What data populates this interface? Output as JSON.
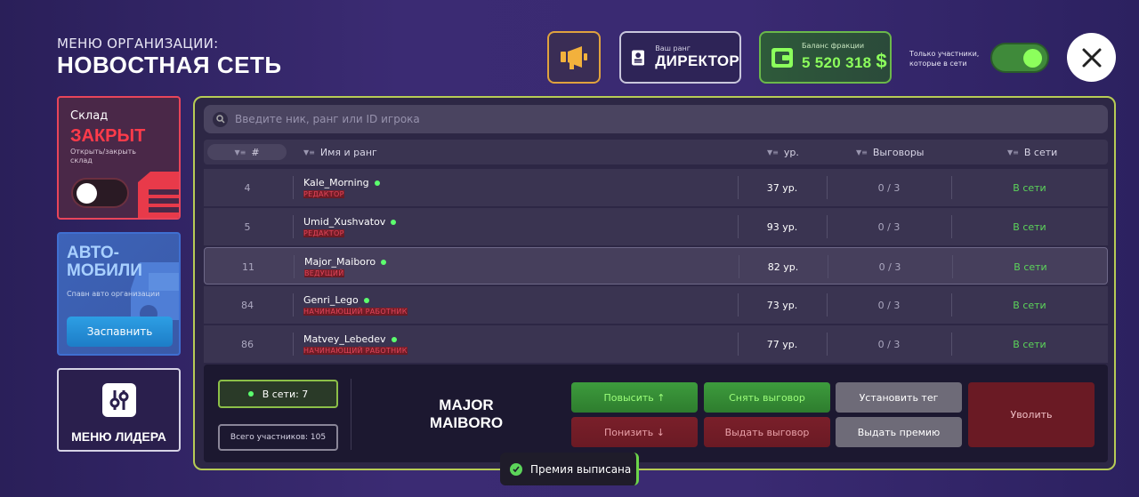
{
  "header": {
    "subtitle": "МЕНЮ ОРГАНИЗАЦИИ:",
    "title": "НОВОСТНАЯ СЕТЬ",
    "rank_caption": "Ваш ранг",
    "rank_value": "ДИРЕКТОР",
    "balance_caption": "Баланс фракции",
    "balance_value": "5 520 318",
    "currency": "$",
    "online_filter_label": "Только участники, которые в сети",
    "online_filter_on": true
  },
  "sidebar": {
    "warehouse": {
      "title": "Склад",
      "status": "ЗАКРЫТ",
      "hint": "Открыть/закрыть склад",
      "toggle_on": false
    },
    "cars": {
      "title_line1": "АВТО-",
      "title_line2": "МОБИЛИ",
      "hint": "Спавн авто организации",
      "button": "Заспавнить"
    },
    "leader": {
      "label": "МЕНЮ ЛИДЕРА"
    }
  },
  "search": {
    "placeholder": "Введите ник, ранг или ID игрока"
  },
  "table": {
    "headers": {
      "num": "#",
      "name": "Имя и ранг",
      "level": "ур.",
      "warnings": "Выговоры",
      "online": "В сети"
    },
    "rows": [
      {
        "num": "4",
        "name": "Kale_Morning",
        "rank": "РЕДАКТОР",
        "level": "37 ур.",
        "warnings": "0 / 3",
        "online": "В сети"
      },
      {
        "num": "5",
        "name": "Umid_Xushvatov",
        "rank": "РЕДАКТОР",
        "level": "93 ур.",
        "warnings": "0 / 3",
        "online": "В сети"
      },
      {
        "num": "11",
        "name": "Major_Maiboro",
        "rank": "ВЕДУЩИЙ",
        "level": "82 ур.",
        "warnings": "0 / 3",
        "online": "В сети"
      },
      {
        "num": "84",
        "name": "Genri_Lego",
        "rank": "НАЧИНАЮЩИЙ РАБОТНИК",
        "level": "73 ур.",
        "warnings": "0 / 3",
        "online": "В сети"
      },
      {
        "num": "86",
        "name": "Matvey_Lebedev",
        "rank": "НАЧИНАЮЩИЙ РАБОТНИК",
        "level": "77 ур.",
        "warnings": "0 / 3",
        "online": "В сети"
      }
    ]
  },
  "bottom": {
    "online_count": "В сети: 7",
    "total_count": "Всего участников: 105",
    "selected_line1": "MAJOR",
    "selected_line2": "MAIBORO",
    "actions": {
      "promote": "Повысить ↑",
      "demote": "Понизить ↓",
      "remove_warning": "Снять выговор",
      "give_warning": "Выдать выговор",
      "set_tag": "Установить тег",
      "give_bonus": "Выдать премию",
      "fire": "Уволить"
    }
  },
  "toast": {
    "message": "Премия выписана"
  },
  "colors": {
    "accent_green": "#8cff5c",
    "accent_red": "#ff3b4a",
    "panel_border": "#b7cc55",
    "flag_border": "#e0a23e"
  }
}
